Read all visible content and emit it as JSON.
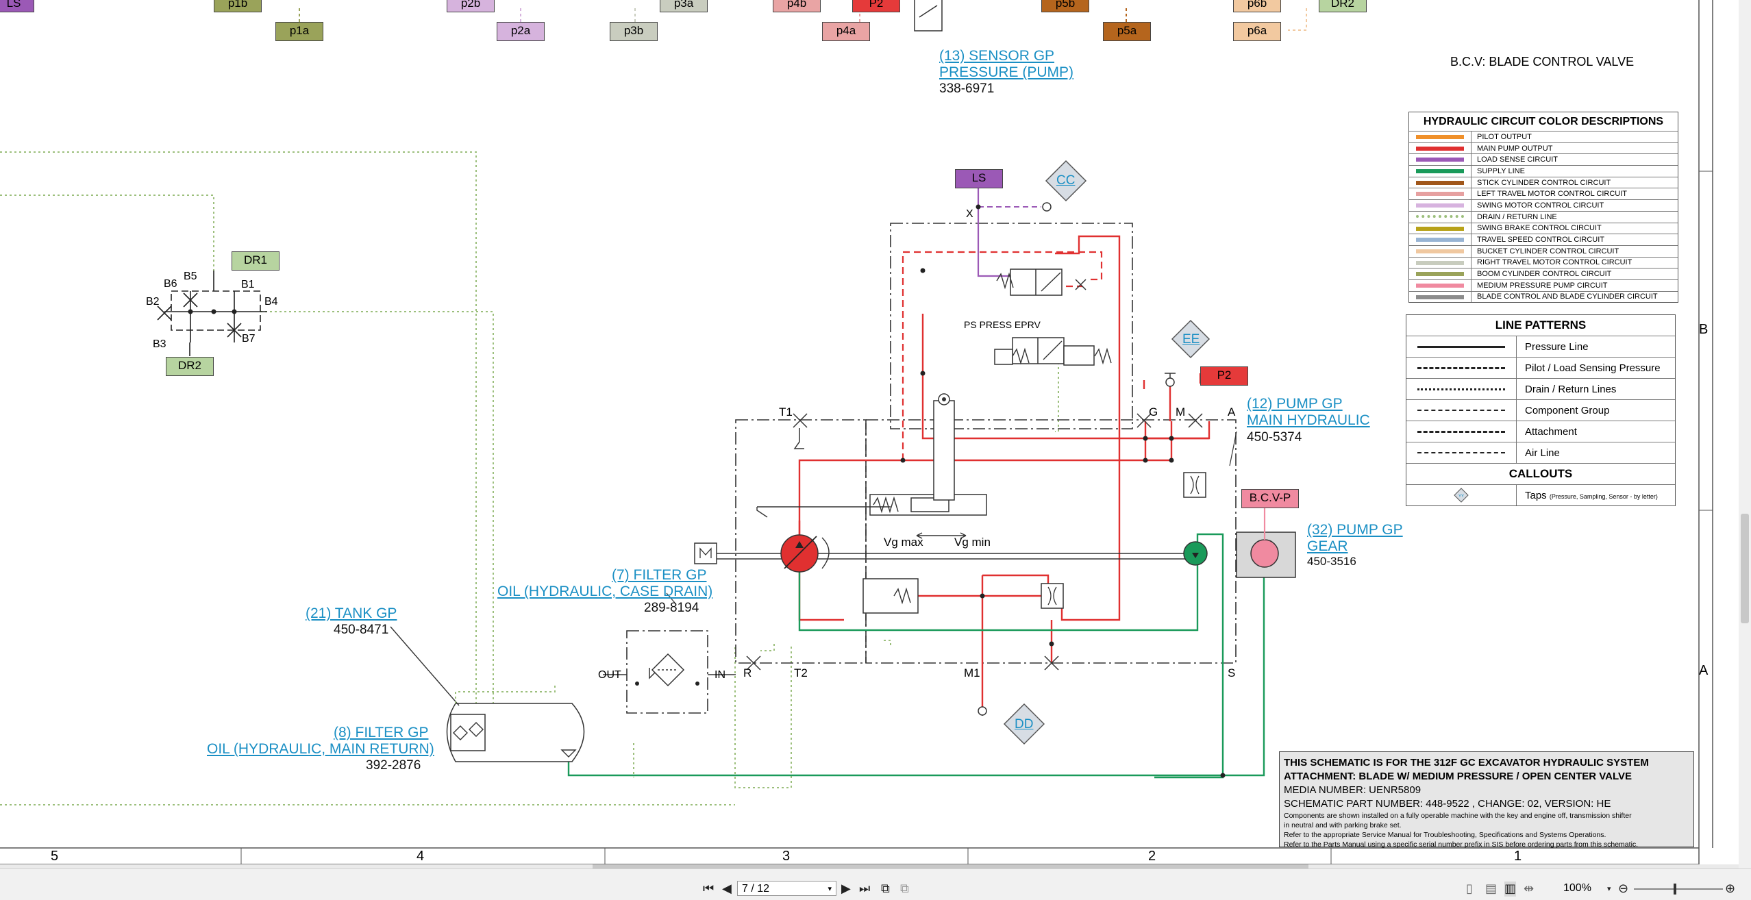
{
  "top_tags": [
    {
      "text": "LS",
      "bg": "#9b59b6"
    },
    {
      "text": "p1b",
      "bg": "#9aa35a"
    },
    {
      "text": "p1a",
      "bg": "#9aa35a"
    },
    {
      "text": "p2b",
      "bg": "#d6b3dd"
    },
    {
      "text": "p2a",
      "bg": "#d6b3dd"
    },
    {
      "text": "p3a",
      "bg": "#c9cdbf"
    },
    {
      "text": "p3b",
      "bg": "#c9cdbf"
    },
    {
      "text": "p4b",
      "bg": "#e9a4a4"
    },
    {
      "text": "P2",
      "bg": "#e53a3a"
    },
    {
      "text": "p4a",
      "bg": "#e9a4a4"
    },
    {
      "text": "p5b",
      "bg": "#b5651d"
    },
    {
      "text": "p5a",
      "bg": "#b5651d"
    },
    {
      "text": "p6b",
      "bg": "#f2c9a0"
    },
    {
      "text": "p6a",
      "bg": "#f2c9a0"
    },
    {
      "text": "DR2",
      "bg": "#b7d4a0"
    }
  ],
  "components": {
    "sensor": {
      "link": "(13) SENSOR GP",
      "link2": "PRESSURE (PUMP)",
      "part": "338-6971"
    },
    "pump_main": {
      "link": "(12) PUMP GP",
      "link2": "MAIN HYDRAULIC",
      "part": "450-5374"
    },
    "pump_gear": {
      "link": "(32) PUMP GP",
      "link2": "GEAR",
      "part": "450-3516"
    },
    "filter_case": {
      "link": "(7) FILTER GP",
      "link2": "OIL (HYDRAULIC, CASE DRAIN)",
      "part": "289-8194"
    },
    "tank": {
      "link": "(21) TANK GP",
      "part": "450-8471"
    },
    "filter_main": {
      "link": "(8) FILTER GP",
      "link2": "OIL (HYDRAULIC, MAIN RETURN)",
      "part": "392-2876"
    }
  },
  "bcv_note": "B.C.V: BLADE CONTROL VALVE",
  "schematic_labels": {
    "ls": "LS",
    "cc": "CC",
    "ee": "EE",
    "dd": "DD",
    "p2": "P2",
    "bcvp": "B.C.V-P",
    "dr1": "DR1",
    "dr2": "DR2",
    "x": "X",
    "ps_press": "PS PRESS EPRV",
    "t1": "T1",
    "g": "G",
    "m": "M",
    "a": "A",
    "r": "R",
    "t2": "T2",
    "m1": "M1",
    "s": "S",
    "vgmax": "Vg max",
    "vgmin": "Vg min",
    "out": "OUT",
    "in": "IN",
    "b1": "B1",
    "b2": "B2",
    "b3": "B3",
    "b4": "B4",
    "b5": "B5",
    "b6": "B6",
    "b7": "B7",
    "m_box": "M"
  },
  "color_legend": {
    "title": "HYDRAULIC CIRCUIT COLOR DESCRIPTIONS",
    "items": [
      {
        "name": "PILOT OUTPUT",
        "color": "#f0902a"
      },
      {
        "name": "MAIN PUMP OUTPUT",
        "color": "#e03030"
      },
      {
        "name": "LOAD SENSE CIRCUIT",
        "color": "#9b59b6"
      },
      {
        "name": "SUPPLY LINE",
        "color": "#1a9a5a"
      },
      {
        "name": "STICK CYLINDER CONTROL CIRCUIT",
        "color": "#a0561a"
      },
      {
        "name": "LEFT TRAVEL MOTOR CONTROL CIRCUIT",
        "color": "#e6a0a0"
      },
      {
        "name": "SWING MOTOR CONTROL CIRCUIT",
        "color": "#d7b3df"
      },
      {
        "name": "DRAIN / RETURN LINE",
        "color": "#9cbf7c",
        "dotted": true
      },
      {
        "name": "SWING BRAKE CONTROL CIRCUIT",
        "color": "#b8a21a"
      },
      {
        "name": "TRAVEL SPEED CONTROL CIRCUIT",
        "color": "#98b4d4"
      },
      {
        "name": "BUCKET CYLINDER CONTROL CIRCUIT",
        "color": "#f0c8a0"
      },
      {
        "name": "RIGHT TRAVEL MOTOR CONTROL CIRCUIT",
        "color": "#c8ccbe"
      },
      {
        "name": "BOOM CYLINDER CONTROL CIRCUIT",
        "color": "#9aa35a"
      },
      {
        "name": "MEDIUM PRESSURE PUMP CIRCUIT",
        "color": "#f08aa0"
      },
      {
        "name": "BLADE CONTROL AND BLADE CYLINDER CIRCUIT",
        "color": "#8c8c8c"
      }
    ]
  },
  "line_patterns": {
    "title": "LINE PATTERNS",
    "items": [
      {
        "name": "Pressure Line",
        "style": "solid"
      },
      {
        "name": "Pilot / Load Sensing Pressure",
        "style": "dashed"
      },
      {
        "name": "Drain / Return Lines",
        "style": "dotted"
      },
      {
        "name": "Component Group",
        "style": "dash-dot"
      },
      {
        "name": "Attachment",
        "style": "long-dash"
      },
      {
        "name": "Air Line",
        "style": "short-dash"
      }
    ],
    "callouts_title": "CALLOUTS",
    "taps_label": "Taps",
    "taps_note": "(Pressure, Sampling, Sensor - by letter)",
    "tap_icon": "YY"
  },
  "title_block": {
    "line1": "THIS SCHEMATIC IS FOR THE 312F GC EXCAVATOR HYDRAULIC SYSTEM",
    "line2": "ATTACHMENT: BLADE W/ MEDIUM PRESSURE / OPEN CENTER VALVE",
    "line3": "MEDIA NUMBER: UENR5809",
    "line4": "SCHEMATIC PART NUMBER: 448-9522 , CHANGE: 02, VERSION: HE",
    "line5": "Components are shown installed on a fully operable machine with the key and engine off, transmission shifter",
    "line6": "in neutral and with parking brake set.",
    "line7": "Refer to the appropriate Service Manual for Troubleshooting, Specifications and Systems Operations.",
    "line8": "Refer to the Parts Manual using a specific serial number prefix in SIS before ordering parts from this schematic."
  },
  "zones_bottom": [
    "5",
    "4",
    "3",
    "2",
    "1"
  ],
  "zones_right": [
    "B",
    "A"
  ],
  "toolbar": {
    "page_value": "7 / 12",
    "zoom": "100%",
    "icons": [
      "first-page-icon",
      "prev-page-icon",
      "next-page-icon",
      "last-page-icon",
      "fit-page-icon",
      "fit-width-icon"
    ]
  }
}
